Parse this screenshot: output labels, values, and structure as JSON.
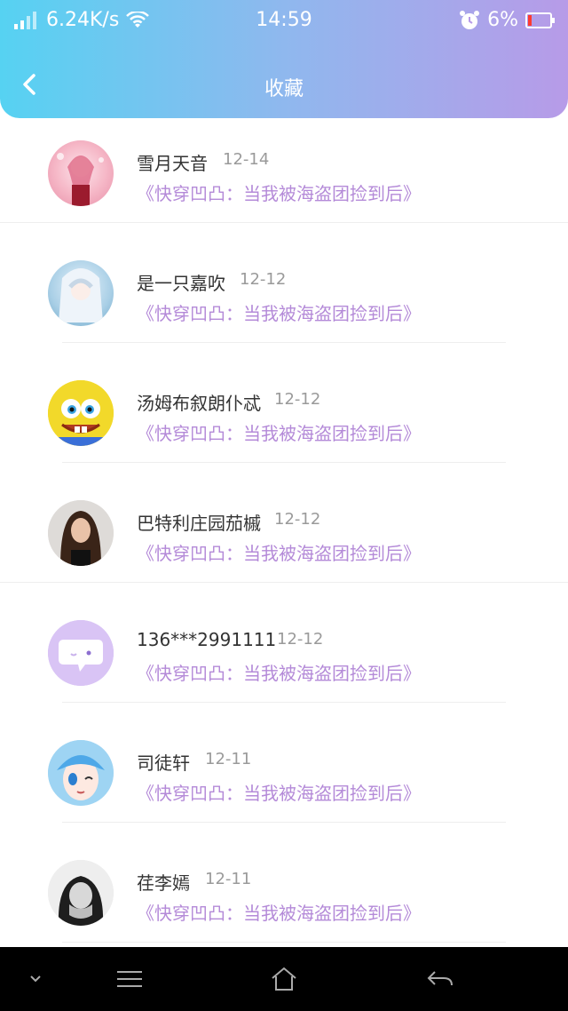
{
  "status_bar": {
    "speed": "6.24K/s",
    "time": "14:59",
    "battery": "6%"
  },
  "header": {
    "title": "收藏",
    "back_icon": "chevron-left-icon",
    "gradient": [
      "#56d2f2",
      "#b79be8"
    ]
  },
  "items": [
    {
      "name": "雪月天音",
      "date": "12-14",
      "book": "《快穿凹凸：当我被海盗团捡到后》"
    },
    {
      "name": "是一只嘉吹",
      "date": "12-12",
      "book": "《快穿凹凸：当我被海盗团捡到后》"
    },
    {
      "name": "汤姆布叙朗仆忒",
      "date": "12-12",
      "book": "《快穿凹凸：当我被海盗团捡到后》"
    },
    {
      "name": "巴特利庄园茄槭",
      "date": "12-12",
      "book": "《快穿凹凸：当我被海盗团捡到后》"
    },
    {
      "name": "136***2991111",
      "date": "12-12",
      "book": "《快穿凹凸：当我被海盗团捡到后》"
    },
    {
      "name": "司徒轩",
      "date": "12-11",
      "book": "《快穿凹凸：当我被海盗团捡到后》"
    },
    {
      "name": "荏李嫣",
      "date": "12-11",
      "book": "《快穿凹凸：当我被海盗团捡到后》"
    }
  ],
  "navbar": {
    "icons": [
      "chevron-down-icon",
      "menu-icon",
      "home-icon",
      "back-arrow-icon"
    ]
  }
}
